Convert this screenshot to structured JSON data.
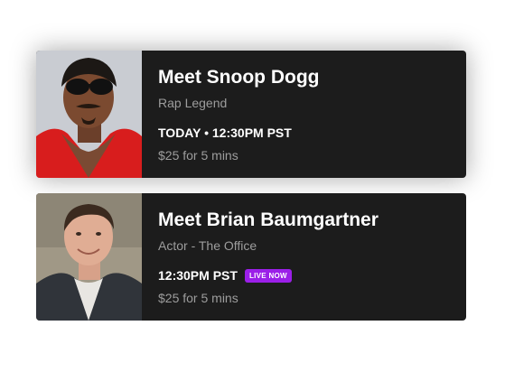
{
  "cards": [
    {
      "name": "Meet Snoop Dogg",
      "subtitle": "Rap Legend",
      "schedule": "TODAY • 12:30PM PST",
      "price": "$25 for 5 mins",
      "photo_icon": "portrait-photo"
    },
    {
      "name": "Meet Brian Baumgartner",
      "subtitle": "Actor - The Office",
      "schedule": "12:30PM PST",
      "badge": "LIVE NOW",
      "price": "$25 for 5 mins",
      "photo_icon": "portrait-photo"
    }
  ],
  "colors": {
    "card_bg": "#1c1c1c",
    "title": "#ffffff",
    "muted": "#9d9d9d",
    "live_badge": "#9b1fe8"
  }
}
